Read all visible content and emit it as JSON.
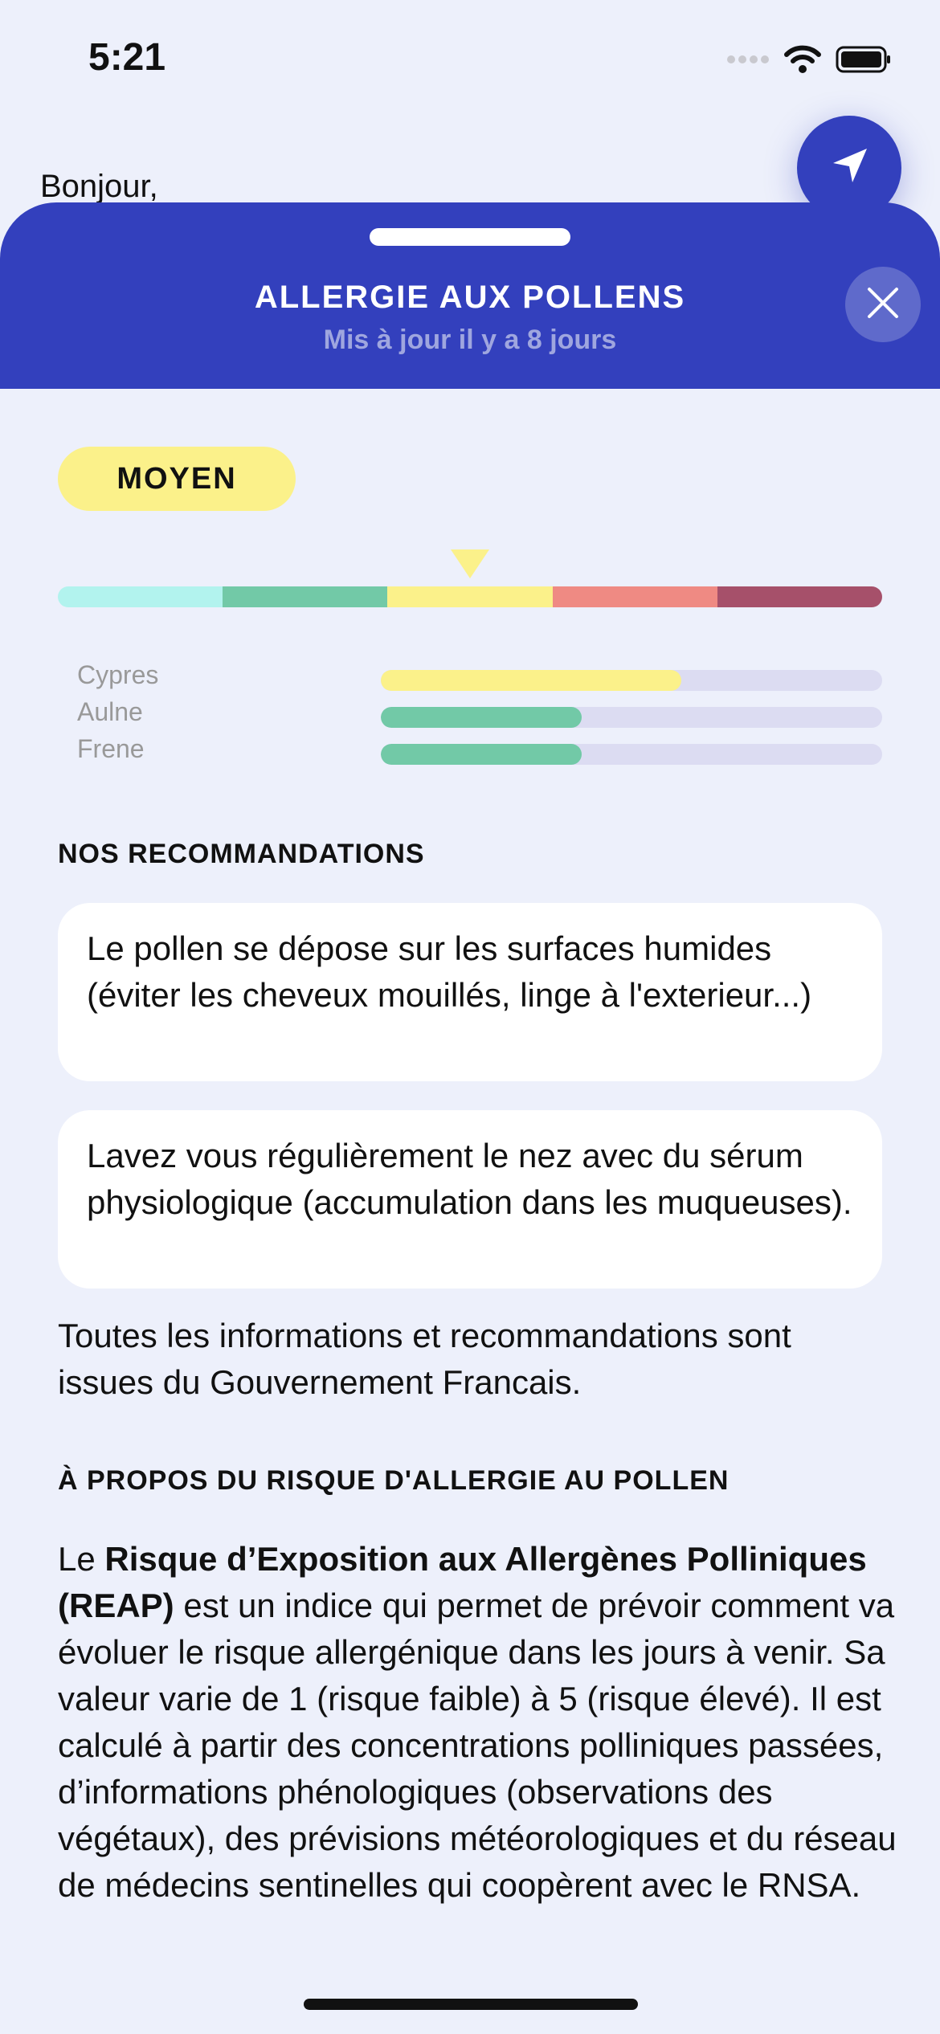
{
  "status_bar": {
    "time": "5:21",
    "icons": [
      "signal-icon",
      "wifi-icon",
      "battery-icon"
    ]
  },
  "home": {
    "greeting": "Bonjour,"
  },
  "sheet": {
    "title": "ALLERGIE AUX POLLENS",
    "subtitle": "Mis à jour il y a 8 jours"
  },
  "risk": {
    "level_label": "MOYEN",
    "level_index": 3,
    "scale_levels": 5,
    "scale_colors": [
      "#b2f3ee",
      "#72c9a7",
      "#fbf18a",
      "#ef8a83",
      "#a6506a"
    ]
  },
  "pollens": [
    {
      "name": "Cypres",
      "level": 0.6,
      "color": "#fbf18a"
    },
    {
      "name": "Aulne",
      "level": 0.4,
      "color": "#72c9a7"
    },
    {
      "name": "Frene",
      "level": 0.4,
      "color": "#72c9a7"
    }
  ],
  "recommendations": {
    "heading": "NOS RECOMMANDATIONS",
    "items": [
      "Le pollen se dépose sur les surfaces humides (éviter les cheveux mouillés, linge à l'exterieur...)",
      "Lavez vous régulièrement le nez avec du sérum physiologique (accumulation dans les muqueuses)."
    ],
    "source": "Toutes les informations et recommandations sont issues du Gouvernement Francais."
  },
  "about": {
    "heading": "À PROPOS DU RISQUE D'ALLERGIE AU POLLEN",
    "intro": "Le ",
    "bold": "Risque d’Exposition aux Allergènes Polliniques (REAP)",
    "body": " est un indice qui permet de prévoir comment va évoluer le risque allergénique dans les jours à venir. Sa valeur varie de 1 (risque faible) à 5 (risque élevé). Il est calculé à partir des concentrations polliniques passées, d’informations phénologiques (observations des végétaux), des prévisions météorologiques et du réseau de médecins sentinelles qui coopèrent avec le RNSA."
  },
  "colors": {
    "primary": "#3340bd",
    "background": "#edf0fb"
  }
}
